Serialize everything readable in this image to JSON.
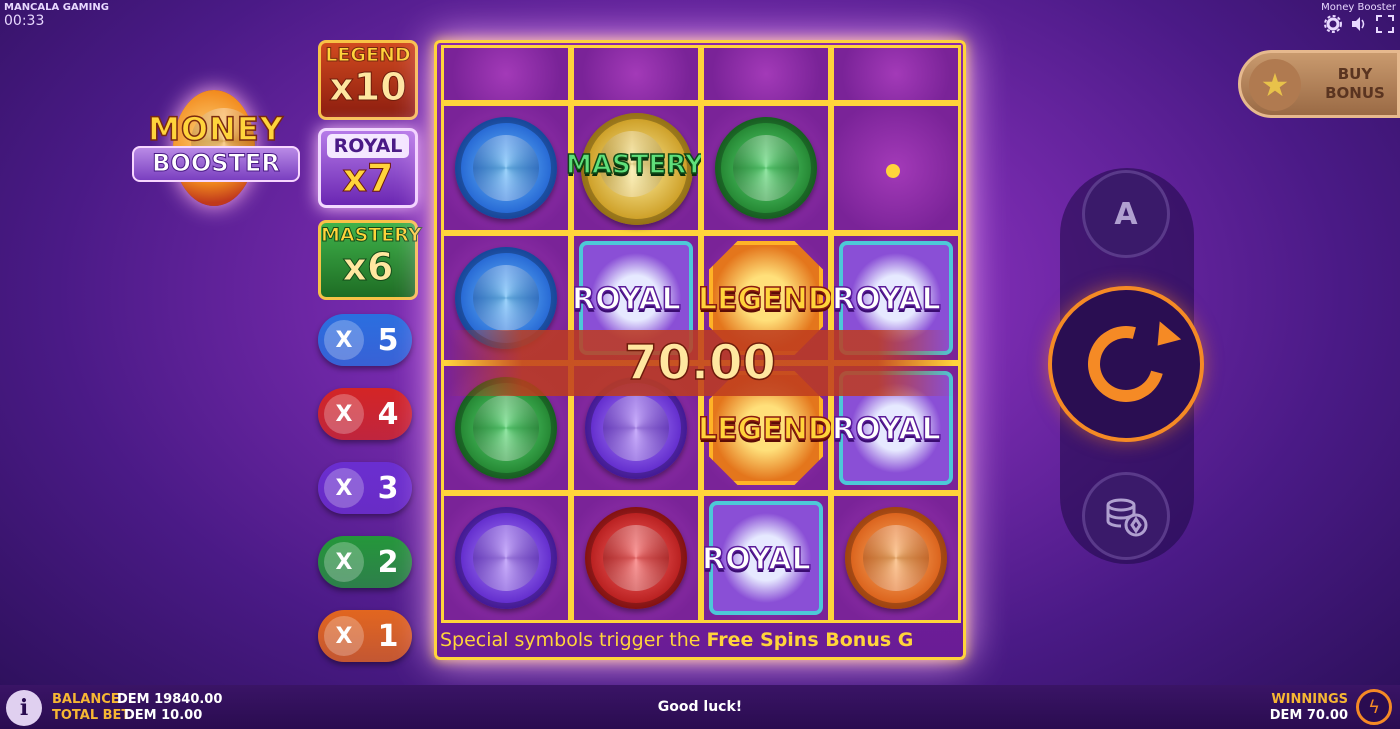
{
  "top": {
    "brand": "MANCALA GAMING",
    "clock": "00:33",
    "game_title": "Money Booster",
    "icons": [
      "gear-icon",
      "speaker-icon",
      "fullscreen-icon"
    ]
  },
  "logo": {
    "line1": "MONEY",
    "line2": "BOOSTER"
  },
  "multipliers": {
    "legend": {
      "label": "LEGEND",
      "value": "x10"
    },
    "royal": {
      "label": "ROYAL",
      "value": "x7"
    },
    "mastery": {
      "label": "MASTERY",
      "value": "x6"
    },
    "pills": [
      {
        "x": "X",
        "n": "5",
        "color": "#2a6fe0"
      },
      {
        "x": "X",
        "n": "4",
        "color": "#d42525"
      },
      {
        "x": "X",
        "n": "3",
        "color": "#6a2ed0"
      },
      {
        "x": "X",
        "n": "2",
        "color": "#24973a"
      },
      {
        "x": "X",
        "n": "1",
        "color": "#e2661f"
      }
    ]
  },
  "reels": {
    "symbol_text": {
      "royal": "ROYAL",
      "legend": "LEGEND",
      "mastery": "MASTERY"
    },
    "win_amount": "70.00"
  },
  "ticker": {
    "prefix": "Special  symbols  trigger  the ",
    "highlight": "Free Spins Bonus G"
  },
  "buy_bonus": {
    "line1": "BUY",
    "line2": "BONUS"
  },
  "controls": {
    "auto_label": "A"
  },
  "bottom": {
    "balance_label": "BALANCE",
    "balance_value": "DEM 19840.00",
    "bet_label": "TOTAL BET",
    "bet_value": "DEM 10.00",
    "message": "Good luck!",
    "winnings_label": "WINNINGS",
    "winnings_value": "DEM 70.00"
  },
  "colors": {
    "accent": "#f58a25",
    "frame": "#ffd43b",
    "label": "#f7b733"
  }
}
